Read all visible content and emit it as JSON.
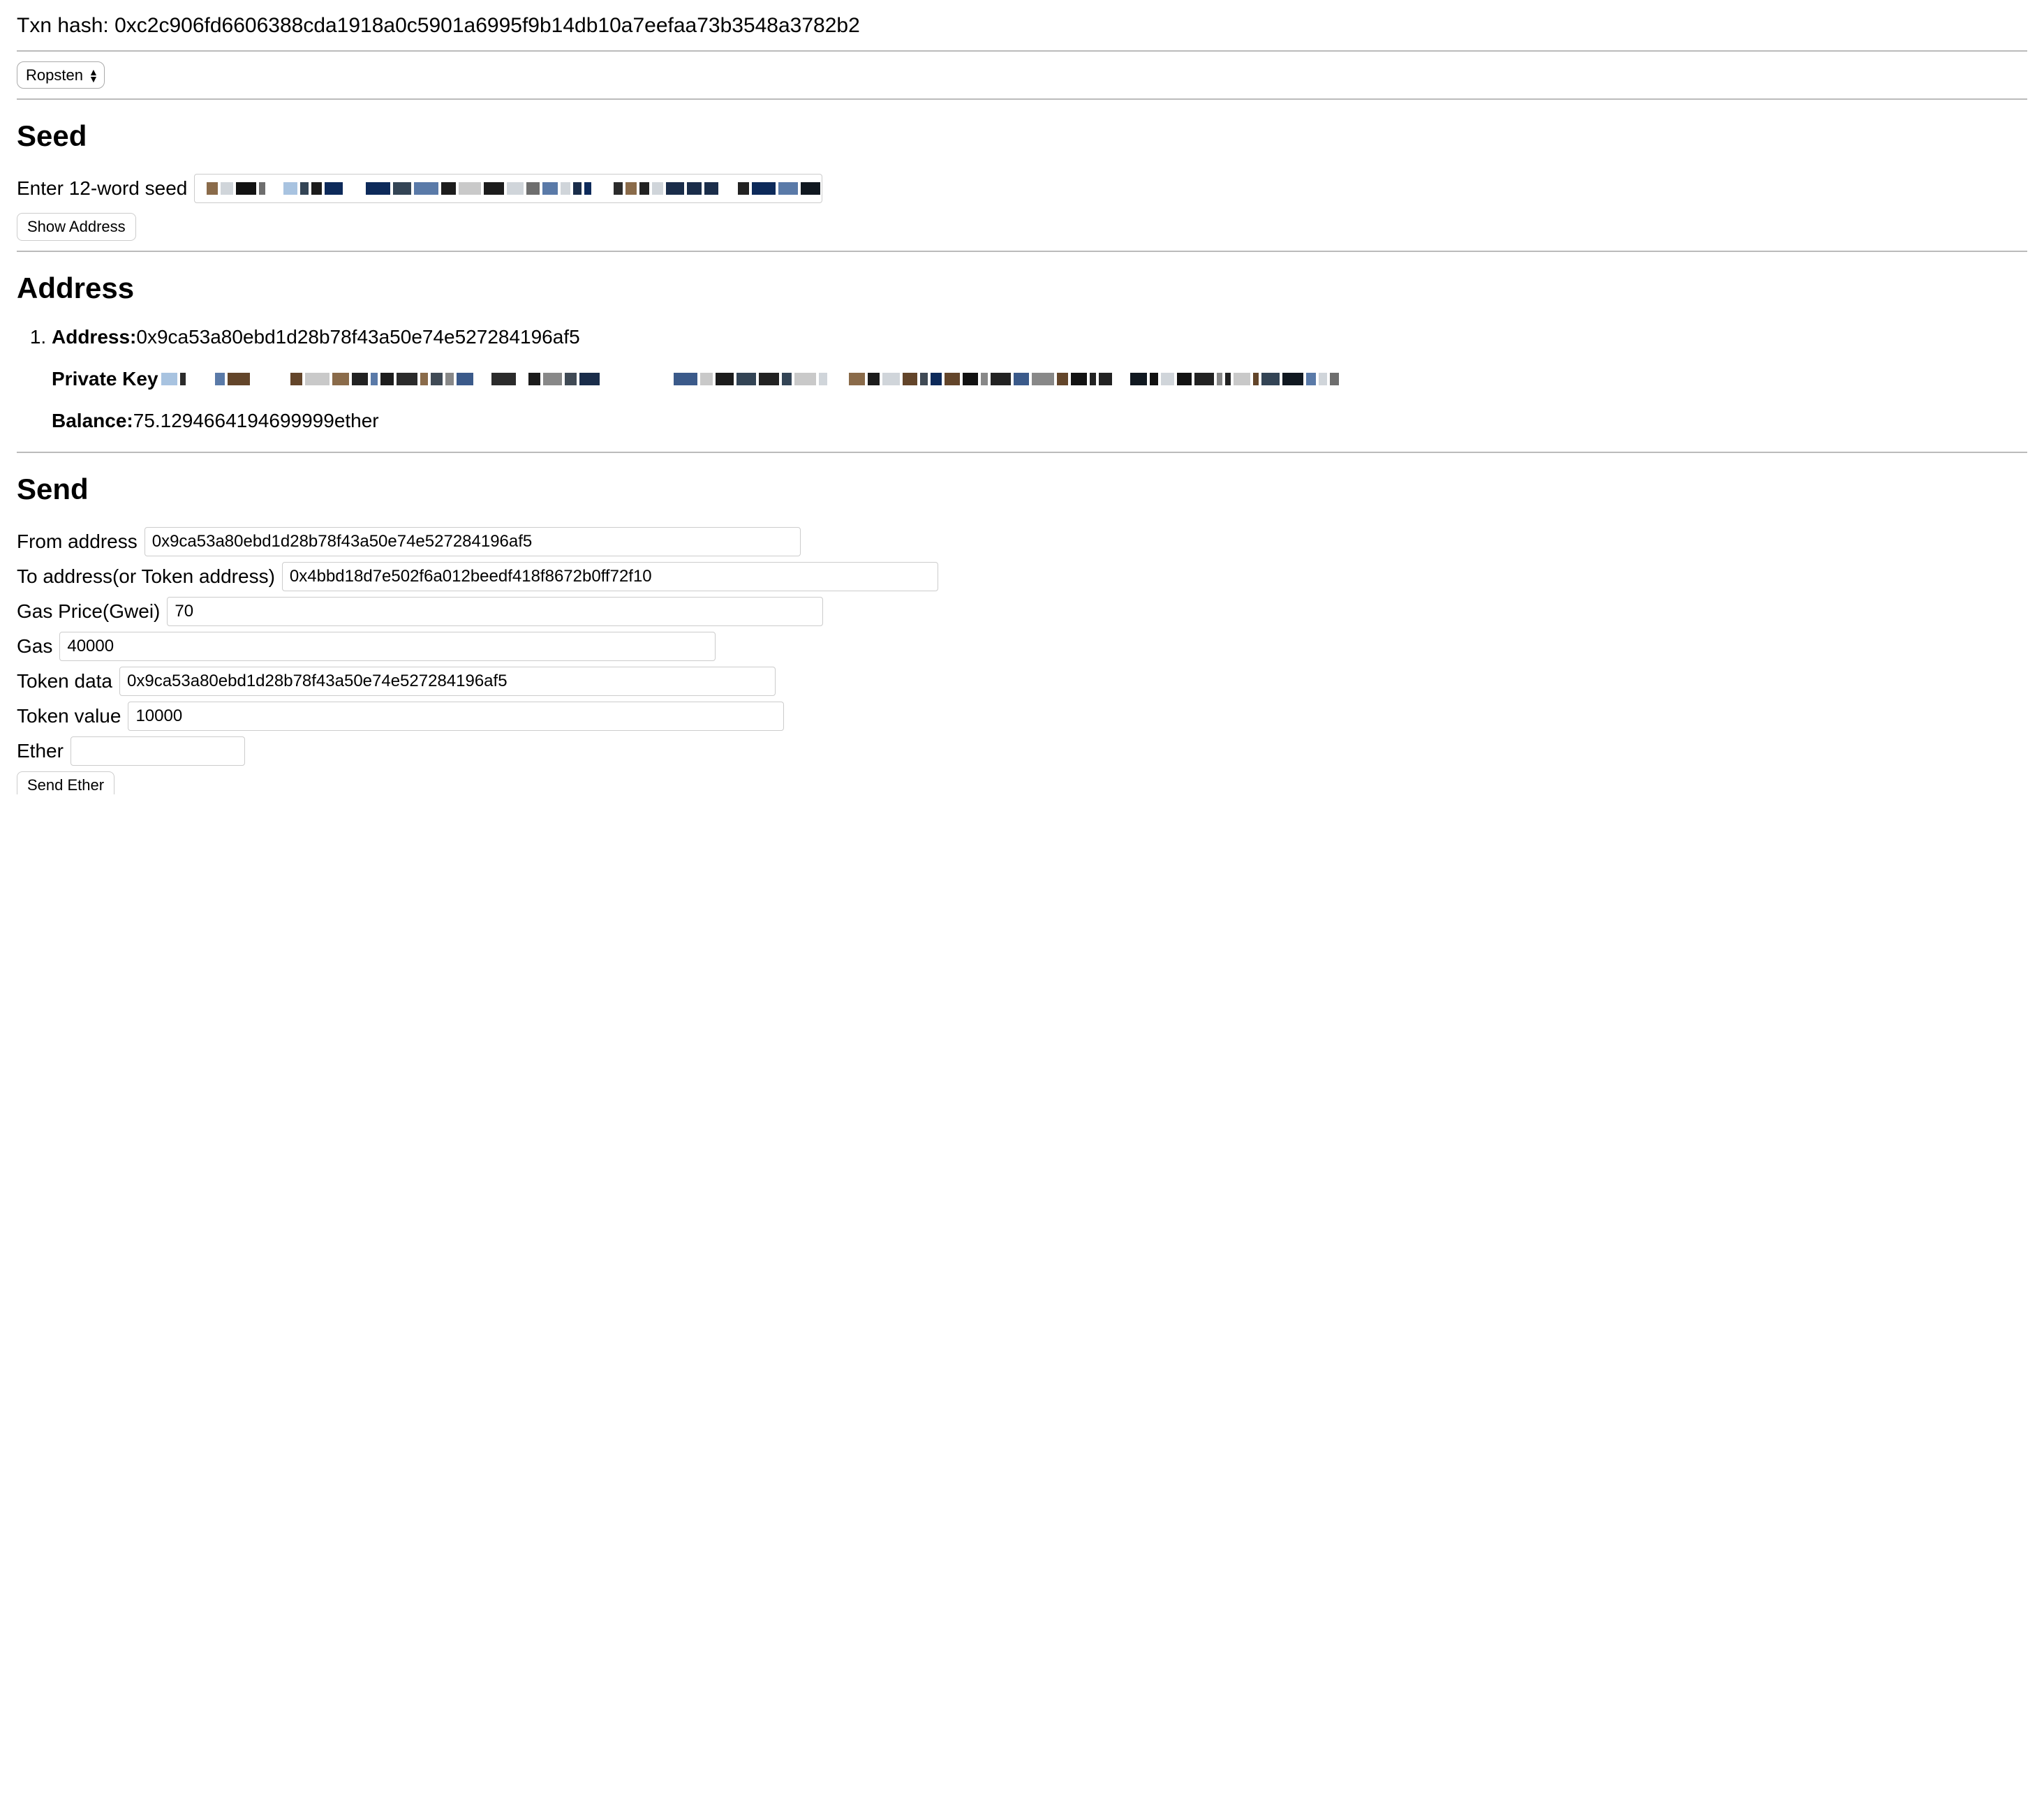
{
  "txn": {
    "label": "Txn hash: ",
    "value": "0xc2c906fd6606388cda1918a0c5901a6995f9b14db10a7eefaa73b3548a3782b2"
  },
  "network_select": {
    "selected": "Ropsten"
  },
  "seed": {
    "heading": "Seed",
    "input_label": "Enter 12-word seed",
    "input_value": "",
    "button_label": "Show Address"
  },
  "address": {
    "heading": "Address",
    "items": [
      {
        "address_label": "Address:",
        "address_value": "0x9ca53a80ebd1d28b78f43a50e74e527284196af5",
        "private_key_label": "Private Key",
        "private_key_value": "",
        "balance_label": "Balance:",
        "balance_value": "75.1294664194699999",
        "balance_unit": "ether"
      }
    ]
  },
  "send": {
    "heading": "Send",
    "from_label": "From address",
    "from_value": "0x9ca53a80ebd1d28b78f43a50e74e527284196af5",
    "to_label": "To address(or Token address)",
    "to_value": "0x4bbd18d7e502f6a012beedf418f8672b0ff72f10",
    "gas_price_label": "Gas Price(Gwei)",
    "gas_price_value": "70",
    "gas_label": "Gas",
    "gas_value": "40000",
    "token_data_label": "Token data",
    "token_data_value": "0x9ca53a80ebd1d28b78f43a50e74e527284196af5",
    "token_value_label": "Token value",
    "token_value_value": "10000",
    "ether_label": "Ether",
    "ether_value": "",
    "send_button_label": "Send Ether"
  }
}
